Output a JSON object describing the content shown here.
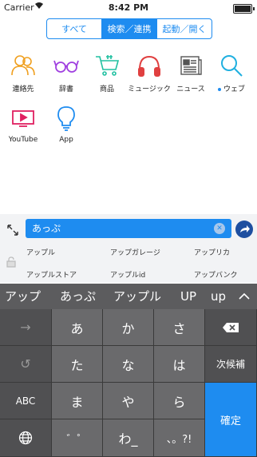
{
  "status": {
    "carrier": "Carrier",
    "time": "8:42 PM"
  },
  "segments": [
    "すべて",
    "検索／連携",
    "起動／開く"
  ],
  "apps": [
    {
      "label": "連絡先",
      "icon": "contacts-icon",
      "color": "#f0a020"
    },
    {
      "label": "辞書",
      "icon": "glasses-icon",
      "color": "#a040e0"
    },
    {
      "label": "商品",
      "icon": "cart-icon",
      "color": "#20c0a0"
    },
    {
      "label": "ミュージック",
      "icon": "headphones-icon",
      "color": "#e04040"
    },
    {
      "label": "ニュース",
      "icon": "newspaper-icon",
      "color": "#555555"
    },
    {
      "label": "ウェブ",
      "icon": "search-icon",
      "color": "#20b0e0"
    },
    {
      "label": "YouTube",
      "icon": "play-icon",
      "color": "#e02060"
    },
    {
      "label": "App",
      "icon": "lightbulb-icon",
      "color": "#1e8cf0"
    }
  ],
  "search": {
    "value": "あっぷ"
  },
  "suggestions": [
    "アップル",
    "アップガレージ",
    "アップリカ",
    "アップルストア",
    "アップルid",
    "アップバンク"
  ],
  "candidates": [
    "アップ",
    "あっぷ",
    "アップル",
    "UP",
    "up"
  ],
  "keyboard": {
    "left": [
      "→",
      "↺",
      "ABC",
      "⊕"
    ],
    "rows": [
      [
        "あ",
        "か",
        "さ"
      ],
      [
        "た",
        "な",
        "は"
      ],
      [
        "ま",
        "や",
        "ら"
      ],
      [
        "゛゜",
        "わ_",
        "、。?!"
      ]
    ],
    "next_candidate": "次候補",
    "confirm": "確定"
  }
}
